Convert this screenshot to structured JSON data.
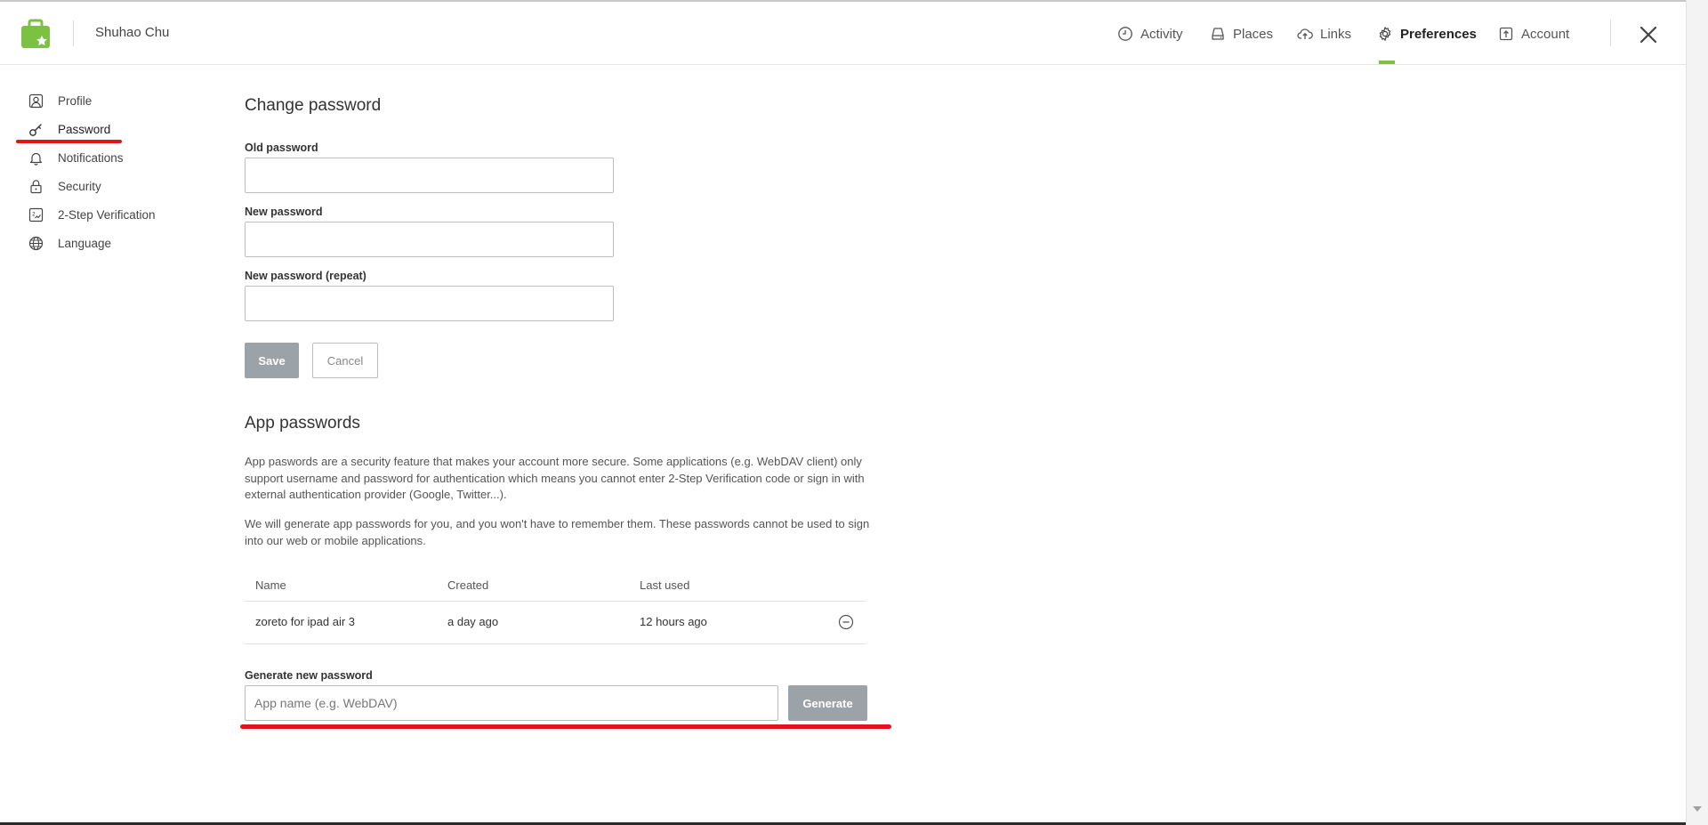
{
  "header": {
    "user_name": "Shuhao Chu",
    "brand_color": "#7cc242",
    "nav": [
      {
        "label": "Activity",
        "icon": "clock-icon"
      },
      {
        "label": "Places",
        "icon": "drive-icon"
      },
      {
        "label": "Links",
        "icon": "cloud-upload-icon"
      },
      {
        "label": "Preferences",
        "icon": "gear-icon",
        "active": true
      },
      {
        "label": "Account",
        "icon": "account-upload-icon"
      }
    ]
  },
  "sidebar": {
    "items": [
      {
        "label": "Profile",
        "icon": "profile-icon"
      },
      {
        "label": "Password",
        "icon": "key-icon",
        "active": true
      },
      {
        "label": "Notifications",
        "icon": "bell-icon"
      },
      {
        "label": "Security",
        "icon": "lock-icon"
      },
      {
        "label": "2-Step Verification",
        "icon": "two-step-icon"
      },
      {
        "label": "Language",
        "icon": "globe-icon"
      }
    ]
  },
  "change_password": {
    "title": "Change password",
    "old_label": "Old password",
    "old_value": "",
    "new_label": "New password",
    "new_value": "",
    "repeat_label": "New password (repeat)",
    "repeat_value": "",
    "save_label": "Save",
    "cancel_label": "Cancel"
  },
  "app_passwords": {
    "title": "App passwords",
    "description_1": "App paswords are a security feature that makes your account more secure. Some applications (e.g. WebDAV client) only support username and password for authentication which means you cannot enter 2-Step Verification code or sign in with external authentication provider (Google, Twitter...).",
    "description_2": "We will generate app passwords for you, and you won't have to remember them. These passwords cannot be used to sign into our web or mobile applications.",
    "columns": [
      "Name",
      "Created",
      "Last used"
    ],
    "rows": [
      {
        "name": "zoreto for ipad air 3",
        "created": "a day ago",
        "last_used": "12 hours ago"
      }
    ],
    "generate_label": "Generate new password",
    "generate_placeholder": "App name (e.g. WebDAV)",
    "generate_value": "",
    "generate_button": "Generate"
  },
  "annotations": {
    "highlight_color": "#e3131c"
  }
}
